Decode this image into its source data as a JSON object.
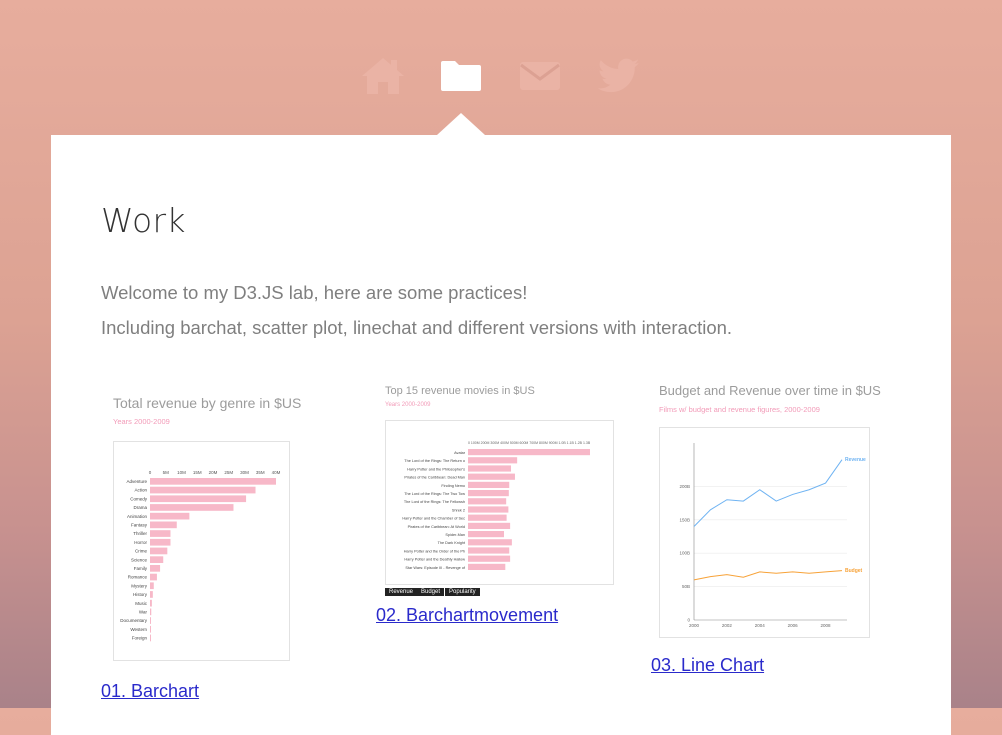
{
  "nav": {
    "items": [
      {
        "name": "home",
        "icon": "home-icon",
        "active": false
      },
      {
        "name": "work",
        "icon": "folder-icon",
        "active": true
      },
      {
        "name": "contact",
        "icon": "envelope-icon",
        "active": false
      },
      {
        "name": "twitter",
        "icon": "twitter-icon",
        "active": false
      }
    ]
  },
  "page": {
    "title": "Work",
    "intro_line1": "Welcome to my D3.JS lab, here are some practices!",
    "intro_line2": "Including barchat, scatter plot, linechat and different versions with interaction."
  },
  "cards": [
    {
      "link": "01. Barchart",
      "thumb_title": "Total revenue by genre in $US",
      "thumb_subtitle": "Years 2000-2009",
      "chart_data": {
        "type": "bar",
        "title": "Total revenue by genre in $US",
        "subtitle": "Years 2000-2009",
        "orientation": "horizontal",
        "tick_labels": [
          "0",
          "5M",
          "10M",
          "15M",
          "20M",
          "25M",
          "30M",
          "35M",
          "40M"
        ],
        "categories": [
          "Adventure",
          "Action",
          "Comedy",
          "Drama",
          "Animation",
          "Fantasy",
          "Thriller",
          "Horror",
          "Crime",
          "Science",
          "Family",
          "Romance",
          "Mystery",
          "History",
          "Music",
          "War",
          "Documentary",
          "Western",
          "Foreign"
        ],
        "values": [
          40,
          33.5,
          30.5,
          26.5,
          12.5,
          8.5,
          6.5,
          6.5,
          5.5,
          4.2,
          3.2,
          2.2,
          1.2,
          0.9,
          0.6,
          0.4,
          0.3,
          0.2,
          0.1
        ],
        "xlim": [
          0,
          40
        ],
        "bar_color": "#f7b8c8"
      }
    },
    {
      "link": "02. Barchartmovement",
      "thumb_title": "Top 15 revenue movies in $US",
      "thumb_subtitle": "Years 2000-2009",
      "buttons": [
        "Revenue",
        "Budget",
        "Popularity"
      ],
      "chart_data": {
        "type": "bar",
        "title": "Top 15 revenue movies in $US",
        "subtitle": "Years 2000-2009",
        "orientation": "horizontal",
        "categories": [
          "Avatar",
          "The Lord of the Rings: The Return o",
          "Harry Potter and the Philosopher's",
          "Pirates of the Caribbean: Dead Man",
          "Finding Nemo",
          "The Lord of the Rings: The Two Tow",
          "The Lord of the Rings: The Fellowsh",
          "Shrek 2",
          "Harry Potter and the Chamber of Sec",
          "Pirates of the Caribbean: At World",
          "Spider-Man",
          "The Dark Knight",
          "Harry Potter and the Order of the Ph",
          "Harry Potter and the Deathly Hallow",
          "Star Wars: Episode III - Revenge of"
        ],
        "values": [
          2.78,
          1.12,
          0.98,
          1.07,
          0.94,
          0.93,
          0.87,
          0.92,
          0.88,
          0.96,
          0.82,
          1.0,
          0.94,
          0.96,
          0.85
        ],
        "bar_color": "#f7b8c8"
      }
    },
    {
      "link": "03. Line Chart",
      "thumb_title": "Budget and Revenue over time in $US",
      "thumb_subtitle": "Films w/ budget and revenue figures, 2000-2009",
      "chart_data": {
        "type": "line",
        "title": "Budget and Revenue over time in $US",
        "subtitle": "Films w/ budget and revenue figures, 2000-2009",
        "x": [
          2000,
          2001,
          2002,
          2003,
          2004,
          2005,
          2006,
          2007,
          2008,
          2009
        ],
        "x_tick_labels": [
          "2000",
          "2002",
          "2004",
          "2006",
          "2008"
        ],
        "y_tick_labels": [
          "0",
          "50B",
          "100B",
          "150B",
          "200B"
        ],
        "ylim": [
          0,
          250
        ],
        "series": [
          {
            "name": "Revenue",
            "color": "#6fb3f2",
            "values": [
              140,
              165,
              180,
              178,
              195,
              178,
              188,
              195,
              205,
              240
            ]
          },
          {
            "name": "Budget",
            "color": "#f7a238",
            "values": [
              60,
              65,
              68,
              64,
              72,
              70,
              72,
              70,
              72,
              74
            ]
          }
        ]
      }
    }
  ]
}
